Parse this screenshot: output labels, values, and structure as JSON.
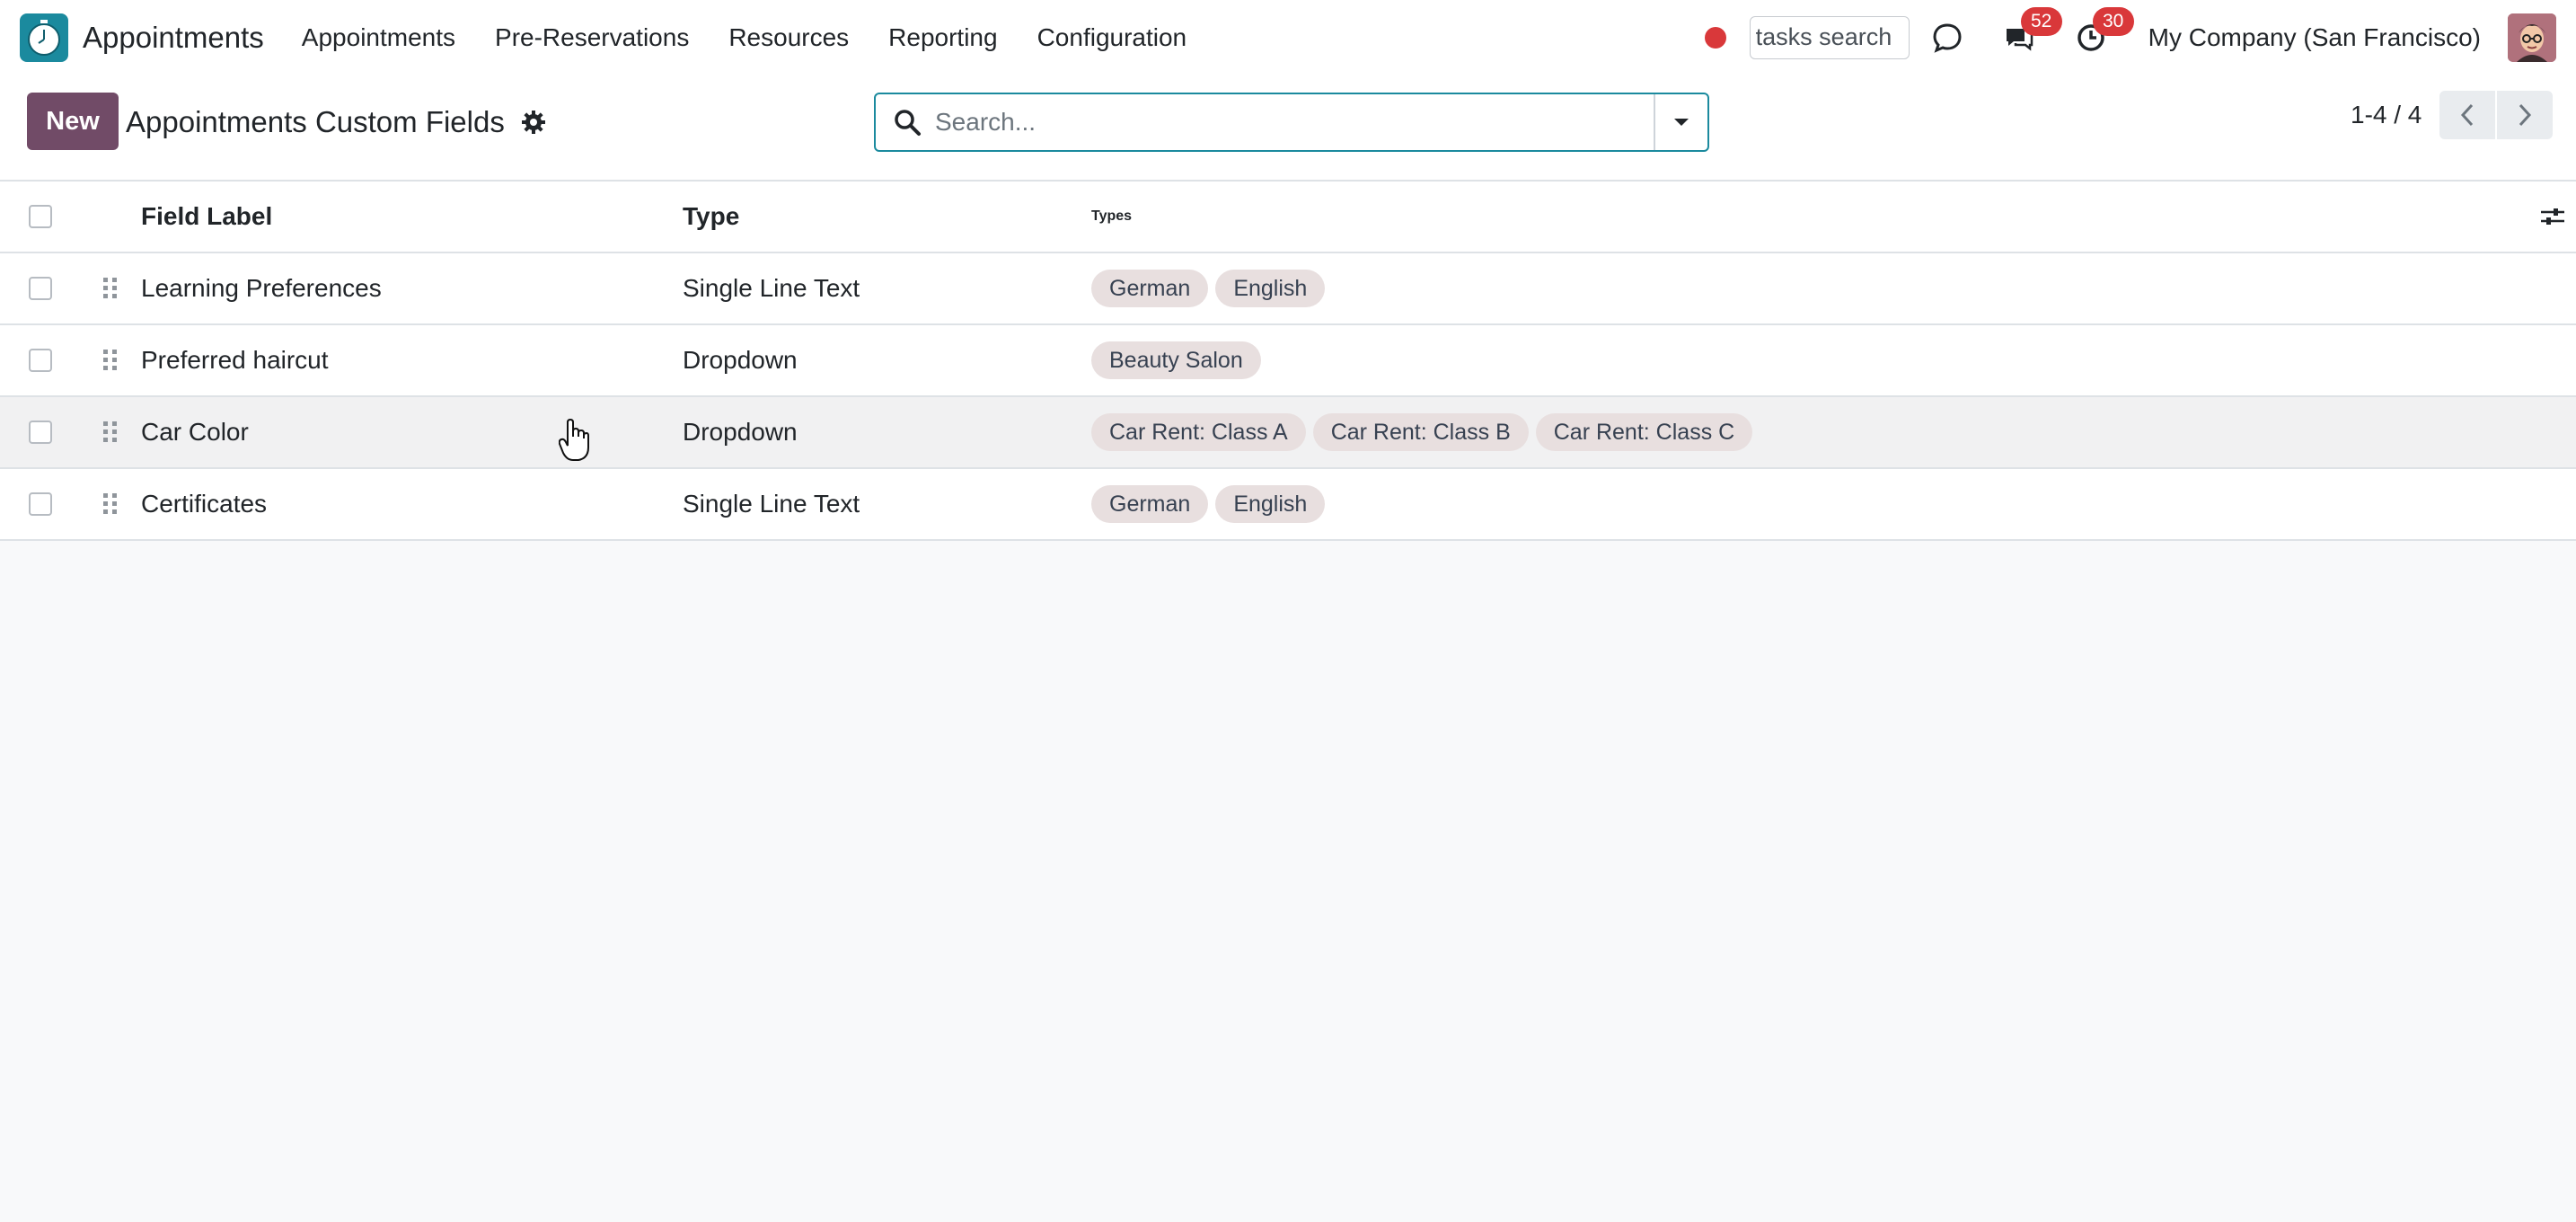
{
  "navbar": {
    "app_name": "Appointments",
    "menu": [
      "Appointments",
      "Pre-Reservations",
      "Resources",
      "Reporting",
      "Configuration"
    ],
    "tasks_search_value": "tasks search",
    "messages_count": "52",
    "activities_count": "30",
    "company": "My Company (San Francisco)",
    "recording_color": "#d9383a"
  },
  "control_panel": {
    "new_label": "New",
    "title": "Appointments Custom Fields",
    "search_placeholder": "Search...",
    "pager_value": "1-4 / 4"
  },
  "list": {
    "columns": {
      "label": "Field Label",
      "type": "Type",
      "types": "Types"
    },
    "rows": [
      {
        "label": "Learning Preferences",
        "type": "Single Line Text",
        "tags": [
          "German",
          "English"
        ]
      },
      {
        "label": "Preferred haircut",
        "type": "Dropdown",
        "tags": [
          "Beauty Salon"
        ]
      },
      {
        "label": "Car Color",
        "type": "Dropdown",
        "tags": [
          "Car Rent: Class A",
          "Car Rent: Class B",
          "Car Rent: Class C"
        ]
      },
      {
        "label": "Certificates",
        "type": "Single Line Text",
        "tags": [
          "German",
          "English"
        ]
      }
    ]
  },
  "colors": {
    "brand": "#714b67",
    "accent": "#1b8a9e",
    "badge": "#d9383a",
    "tag_bg": "#e8dfdf"
  }
}
